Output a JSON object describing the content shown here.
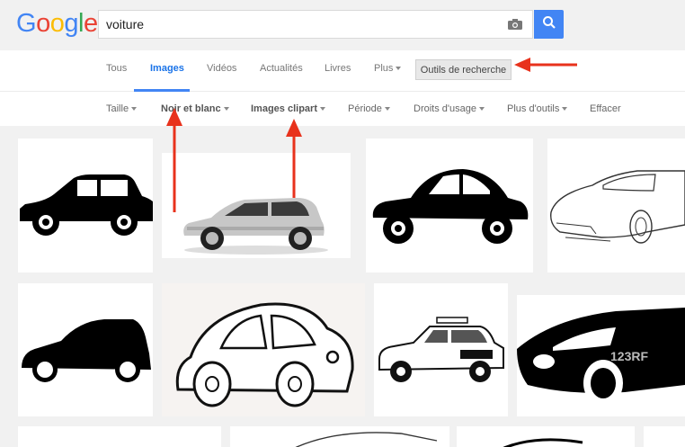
{
  "header": {
    "logo": [
      "G",
      "o",
      "o",
      "g",
      "l",
      "e"
    ],
    "logo_colors": [
      "#4285f4",
      "#ea4335",
      "#fbbc05",
      "#4285f4",
      "#34a853",
      "#ea4335"
    ],
    "search_value": "voiture",
    "camera_icon": "camera-icon",
    "search_icon": "search-icon"
  },
  "tabs": {
    "items": [
      "Tous",
      "Images",
      "Vidéos",
      "Actualités",
      "Livres",
      "Plus"
    ],
    "active": "Images",
    "tools": "Outils de recherche"
  },
  "filters": {
    "items": [
      "Taille",
      "Noir et blanc",
      "Images clipart",
      "Période",
      "Droits d'usage",
      "Plus d'outils",
      "Effacer"
    ]
  },
  "colors": {
    "accent": "#4285f4",
    "annotation_arrow": "#e8321c"
  },
  "results": {
    "watermark": "123RF"
  }
}
